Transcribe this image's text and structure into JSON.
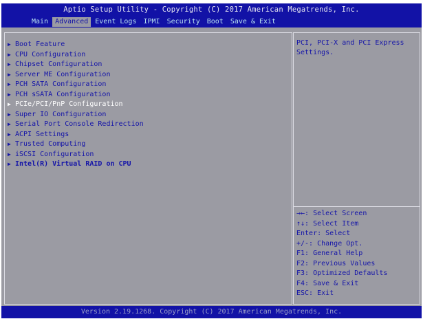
{
  "header": {
    "title": "Aptio Setup Utility - Copyright (C) 2017 American Megatrends, Inc.",
    "tabs": [
      {
        "label": "Main"
      },
      {
        "label": "Advanced"
      },
      {
        "label": "Event Logs"
      },
      {
        "label": "IPMI"
      },
      {
        "label": "Security"
      },
      {
        "label": "Boot"
      },
      {
        "label": "Save & Exit"
      }
    ],
    "active_tab": "Advanced"
  },
  "menu": {
    "items": [
      {
        "label": "Boot Feature"
      },
      {
        "label": "CPU Configuration"
      },
      {
        "label": "Chipset Configuration"
      },
      {
        "label": "Server ME Configuration"
      },
      {
        "label": "PCH SATA Configuration"
      },
      {
        "label": "PCH sSATA Configuration"
      },
      {
        "label": "PCIe/PCI/PnP Configuration"
      },
      {
        "label": "Super IO Configuration"
      },
      {
        "label": "Serial Port Console Redirection"
      },
      {
        "label": "ACPI Settings"
      },
      {
        "label": "Trusted Computing"
      },
      {
        "label": "iSCSI Configuration"
      },
      {
        "label": "Intel(R) Virtual RAID on CPU"
      }
    ],
    "selected": "PCIe/PCI/PnP Configuration"
  },
  "help": {
    "text": "PCI, PCI-X and PCI Express\nSettings."
  },
  "keys": [
    "→←: Select Screen",
    "↑↓: Select Item",
    "Enter: Select",
    "+/-: Change Opt.",
    "F1: General Help",
    "F2: Previous Values",
    "F3: Optimized Defaults",
    "F4: Save & Exit",
    "ESC: Exit"
  ],
  "footer": {
    "text": "Version 2.19.1268. Copyright (C) 2017 American Megatrends, Inc."
  },
  "colors": {
    "header_bg": "#1212a6",
    "panel_bg": "#9b9ba3",
    "text_blue": "#1414a8",
    "selected_text": "#ffffff"
  },
  "icons": {
    "menu_item": "triangle-right-icon"
  }
}
